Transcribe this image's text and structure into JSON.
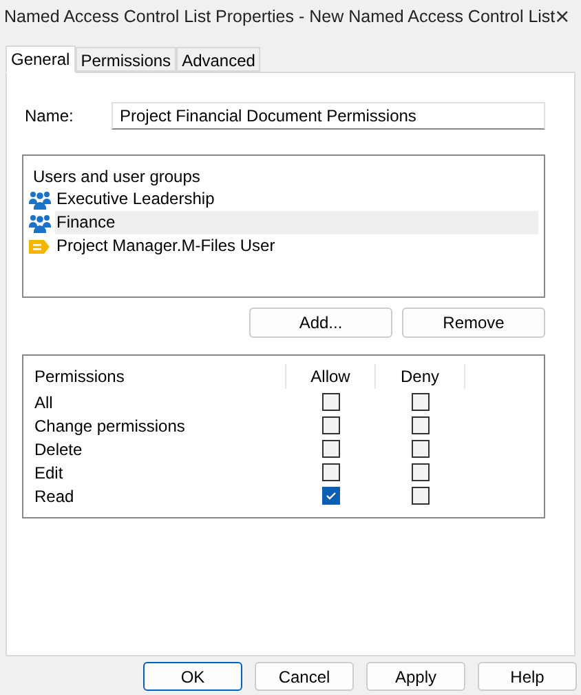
{
  "window": {
    "title": "Named Access Control List Properties - New Named Access Control List",
    "close": "×"
  },
  "tabs": [
    {
      "label": "General",
      "selected": true
    },
    {
      "label": "Permissions",
      "selected": false
    },
    {
      "label": "Advanced",
      "selected": false
    }
  ],
  "name_field": {
    "label": "Name:",
    "value": "Project Financial Document Permissions"
  },
  "users": {
    "heading": "Users and user groups",
    "items": [
      {
        "label": "Executive Leadership",
        "kind": "group",
        "selected": false
      },
      {
        "label": "Finance",
        "kind": "group",
        "selected": true
      },
      {
        "label": "Project Manager.M-Files User",
        "kind": "user",
        "selected": false
      }
    ]
  },
  "user_buttons": [
    "Add...",
    "Remove"
  ],
  "permissions": {
    "columns": [
      "Permissions",
      "Allow",
      "Deny"
    ],
    "rows": [
      {
        "label": "All",
        "allow": false,
        "deny": false
      },
      {
        "label": "Change permissions",
        "allow": false,
        "deny": false
      },
      {
        "label": "Delete",
        "allow": false,
        "deny": false
      },
      {
        "label": "Edit",
        "allow": false,
        "deny": false
      },
      {
        "label": "Read",
        "allow": true,
        "deny": false
      }
    ]
  },
  "buttons": [
    {
      "label": "OK",
      "default": true
    },
    {
      "label": "Cancel",
      "default": false
    },
    {
      "label": "Apply",
      "default": false
    },
    {
      "label": "Help",
      "default": false
    }
  ]
}
